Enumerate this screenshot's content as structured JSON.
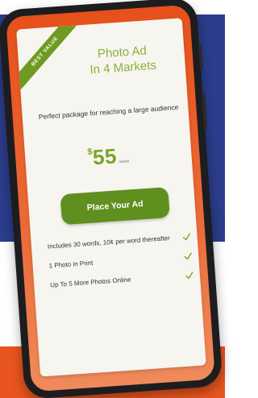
{
  "pricing_card": {
    "ribbon": "BEST VALUE",
    "title_line1": "Photo Ad",
    "title_line2": "In 4 Markets",
    "description": "Perfect package for reaching a large audience",
    "price_currency": "$",
    "price_amount": "55",
    "price_unit": "/week",
    "cta_label": "Place Your Ad",
    "features": [
      "Includes 30 words, 10¢ per word thereafter",
      "1 Photo in Print",
      "Up To 5 More Photos Online"
    ]
  },
  "colors": {
    "background_blue": "#2b3d8c",
    "background_orange": "#e8551e",
    "accent_green": "#6e9a22",
    "button_green": "#5f8f1e"
  },
  "icons": {
    "feature_check": "check-icon"
  }
}
